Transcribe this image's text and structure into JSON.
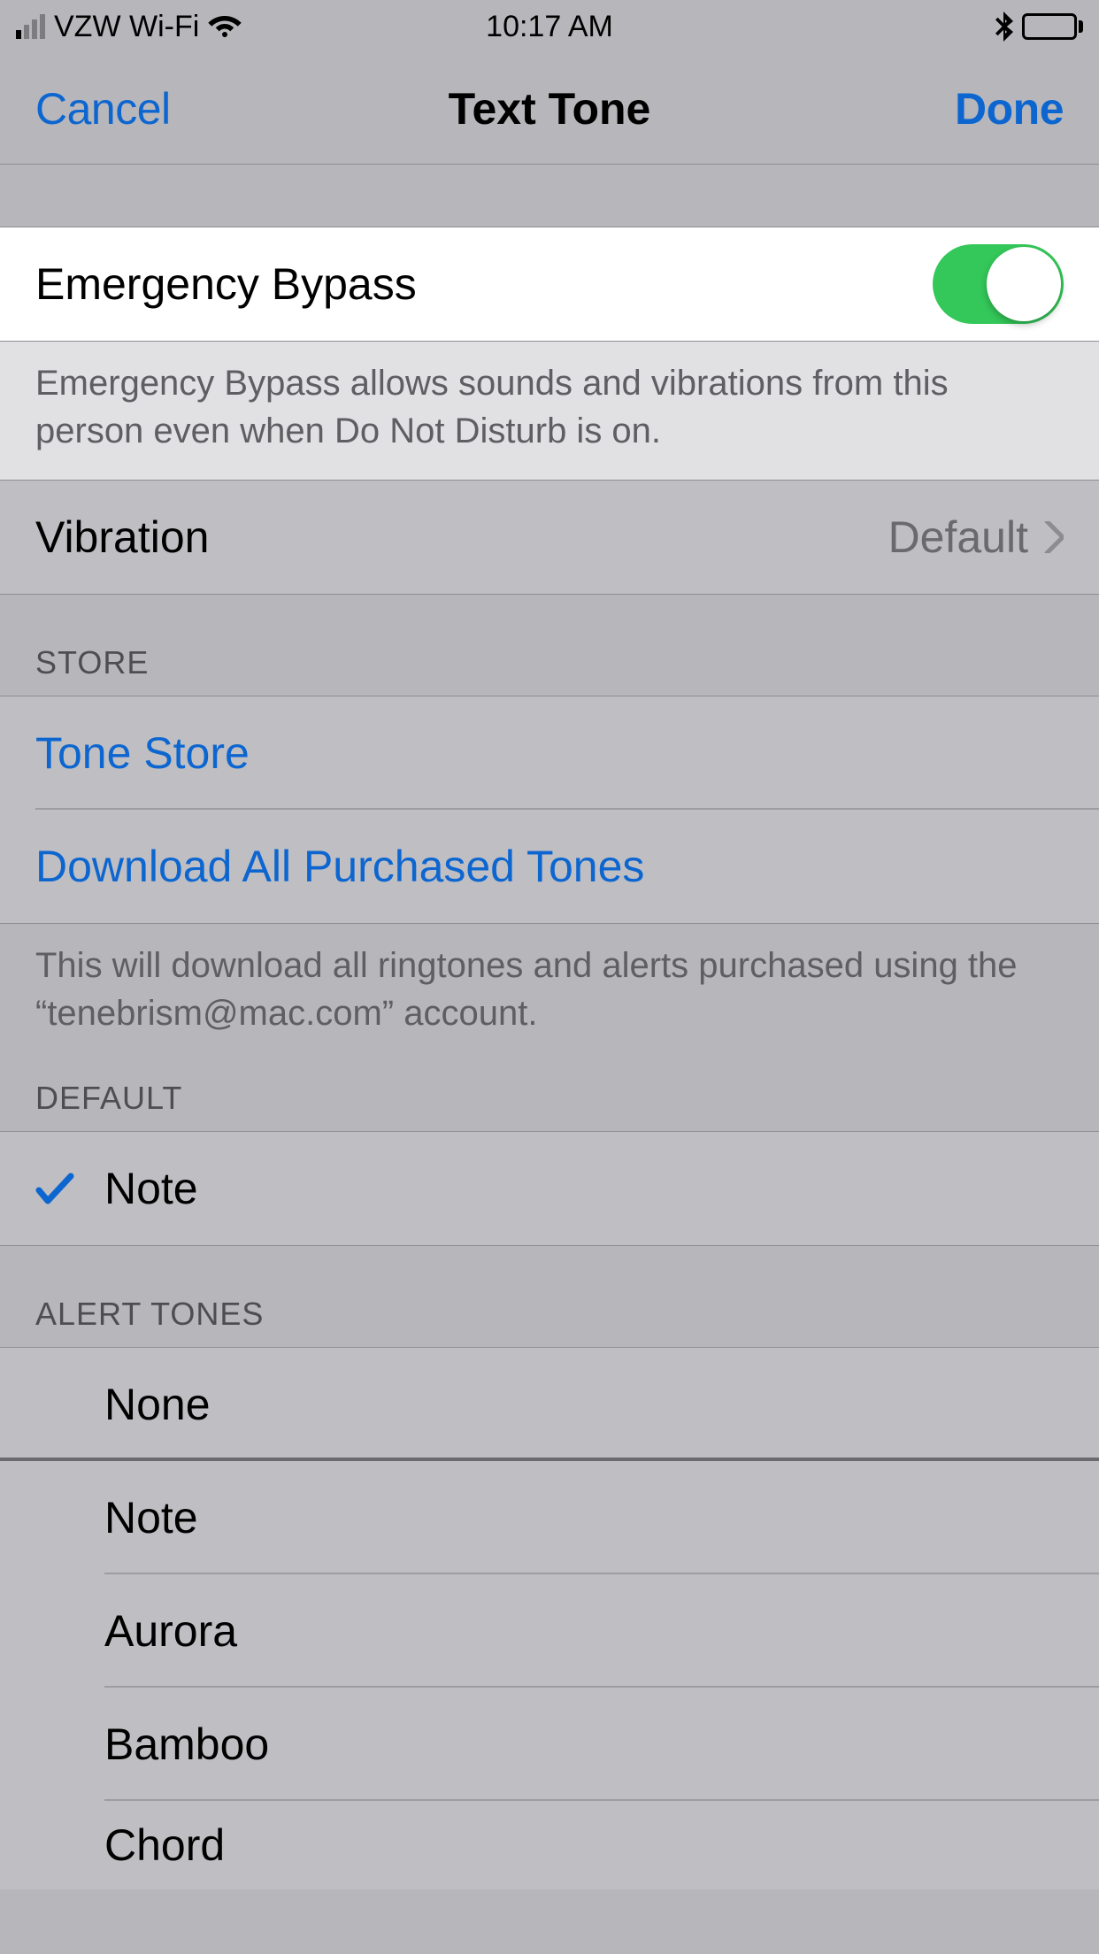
{
  "status": {
    "carrier": "VZW Wi-Fi",
    "time": "10:17 AM"
  },
  "nav": {
    "cancel": "Cancel",
    "title": "Text Tone",
    "done": "Done"
  },
  "emergency": {
    "label": "Emergency Bypass",
    "on": true,
    "footer": "Emergency Bypass allows sounds and vibrations from this person even when Do Not Disturb is on."
  },
  "vibration": {
    "label": "Vibration",
    "value": "Default"
  },
  "store": {
    "header": "STORE",
    "tone_store": "Tone Store",
    "download": "Download All Purchased Tones",
    "footer": "This will download all ringtones and alerts purchased using the “tenebrism@mac.com” account."
  },
  "default_section": {
    "header": "DEFAULT",
    "selected": "Note"
  },
  "alert_tones": {
    "header": "ALERT TONES",
    "items": [
      "None",
      "Note",
      "Aurora",
      "Bamboo",
      "Chord"
    ]
  },
  "colors": {
    "link": "#0d66d0",
    "toggle_on": "#34c759"
  }
}
